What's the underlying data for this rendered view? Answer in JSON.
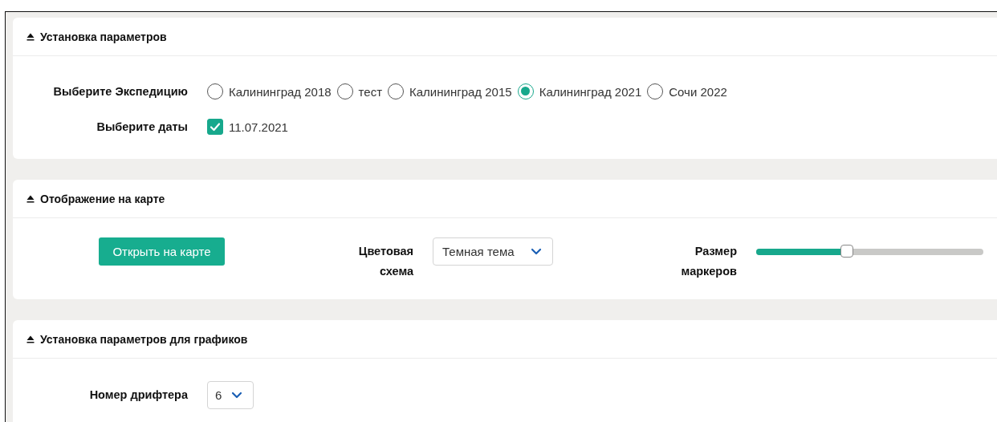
{
  "sections": [
    {
      "title": "Установка параметров",
      "expanded": true,
      "kind": "params",
      "expedition": {
        "label": "Выберите Экспедицию",
        "options": [
          {
            "label": "Калининград 2018",
            "selected": false
          },
          {
            "label": "тест",
            "selected": false
          },
          {
            "label": "Калининград 2015",
            "selected": false
          },
          {
            "label": "Калининград 2021",
            "selected": true
          },
          {
            "label": "Сочи 2022",
            "selected": false
          }
        ]
      },
      "dates": {
        "label": "Выберите даты",
        "options": [
          {
            "label": "11.07.2021",
            "checked": true
          }
        ]
      }
    },
    {
      "title": "Отображение на карте",
      "expanded": true,
      "kind": "map",
      "open_button": "Открыть на карте",
      "color_scheme": {
        "label": "Цветовая схема",
        "value": "Темная тема"
      },
      "marker_size": {
        "label": "Размер маркеров",
        "level": 0.4
      }
    },
    {
      "title": "Установка параметров для графиков",
      "expanded": true,
      "kind": "charts",
      "drifter": {
        "label": "Номер дрифтера",
        "value": "6"
      }
    }
  ]
}
